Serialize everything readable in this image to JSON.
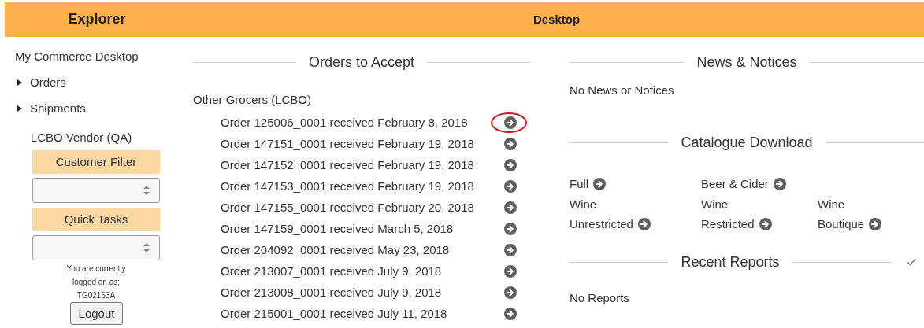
{
  "header": {
    "left_title": "Explorer",
    "title": "Desktop"
  },
  "sidebar": {
    "title": "My Commerce Desktop",
    "items": [
      {
        "label": "Orders",
        "expanded": false
      },
      {
        "label": "Shipments",
        "expanded": false
      }
    ],
    "vendor": "LCBO Vendor (QA)",
    "customer_filter": {
      "label": "Customer Filter"
    },
    "quick_tasks": {
      "label": "Quick Tasks"
    },
    "logged_on_text": [
      "You are currently",
      "logged on as:",
      "TG02163A"
    ],
    "logout_button": "Logout"
  },
  "orders": {
    "title": "Orders to Accept",
    "group": "Other Grocers (LCBO)",
    "items": [
      {
        "text": "Order 125006_0001 received February 8, 2018",
        "highlighted": true
      },
      {
        "text": "Order 147151_0001 received February 19, 2018",
        "highlighted": false
      },
      {
        "text": "Order 147152_0001 received February 19, 2018",
        "highlighted": false
      },
      {
        "text": "Order 147153_0001 received February 19, 2018",
        "highlighted": false
      },
      {
        "text": "Order 147155_0001 received February 20, 2018",
        "highlighted": false
      },
      {
        "text": "Order 147159_0001 received March 5, 2018",
        "highlighted": false
      },
      {
        "text": "Order 204092_0001 received May 23, 2018",
        "highlighted": false
      },
      {
        "text": "Order 213007_0001 received July 9, 2018",
        "highlighted": false
      },
      {
        "text": "Order 213008_0001 received July 9, 2018",
        "highlighted": false
      },
      {
        "text": "Order 215001_0001 received July 11, 2018",
        "highlighted": false
      }
    ]
  },
  "news": {
    "title": "News & Notices",
    "message": "No News or Notices"
  },
  "catalogue": {
    "title": "Catalogue Download",
    "items": [
      {
        "kind": "link",
        "lines": [
          "Full"
        ]
      },
      {
        "kind": "link",
        "lines": [
          "Beer & Cider"
        ]
      },
      {
        "kind": "empty"
      },
      {
        "kind": "link",
        "lines": [
          "Wine",
          "Unrestricted"
        ]
      },
      {
        "kind": "link",
        "lines": [
          "Wine",
          "Restricted"
        ]
      },
      {
        "kind": "link",
        "lines": [
          "Wine",
          "Boutique"
        ]
      }
    ]
  },
  "reports": {
    "title": "Recent Reports",
    "message": "No Reports"
  }
}
